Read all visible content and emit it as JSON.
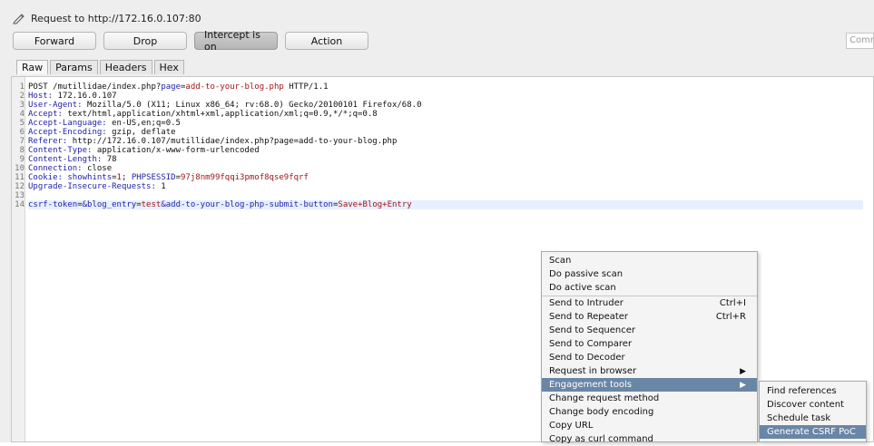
{
  "window": {
    "title": "Request to http://172.16.0.107:80"
  },
  "toolbar": {
    "forward": "Forward",
    "drop": "Drop",
    "intercept": "Intercept is on",
    "action": "Action",
    "comment_placeholder": "Comm"
  },
  "tabs": [
    "Raw",
    "Params",
    "Headers",
    "Hex"
  ],
  "editor": {
    "line_numbers": [
      "1",
      "2",
      "3",
      "4",
      "5",
      "6",
      "7",
      "8",
      "9",
      "10",
      "11",
      "12",
      "13",
      "14"
    ],
    "lines": [
      {
        "key": "POST /mutillidae/index.php?",
        "k2": "page",
        "eq": "=",
        "v": "add-to-your-blog.php",
        "rest": " HTTP/1.1"
      },
      {
        "key": "Host:",
        "v": " 172.16.0.107"
      },
      {
        "key": "User-Agent:",
        "v": " Mozilla/5.0 (X11; Linux x86_64; rv:68.0) Gecko/20100101 Firefox/68.0"
      },
      {
        "key": "Accept:",
        "v": " text/html,application/xhtml+xml,application/xml;q=0.9,*/*;q=0.8"
      },
      {
        "key": "Accept-Language:",
        "v": " en-US,en;q=0.5"
      },
      {
        "key": "Accept-Encoding:",
        "v": " gzip, deflate"
      },
      {
        "key": "Referer:",
        "v": " http://172.16.0.107/mutillidae/index.php?page=add-to-your-blog.php"
      },
      {
        "key": "Content-Type:",
        "v": " application/x-www-form-urlencoded"
      },
      {
        "key": "Content-Length:",
        "v": " 78"
      },
      {
        "key": "Connection:",
        "v": " close"
      },
      {
        "key": "Cookie:",
        "c1": " showhints",
        "c1eq": "=",
        "c1v": "1",
        "sep": "; ",
        "c2": "PHPSESSID",
        "c2eq": "=",
        "c2v": "97j8nm99fqqi3pmof8qse9fqrf"
      },
      {
        "key": "Upgrade-Insecure-Requests:",
        "v": " 1"
      },
      {
        "key": "",
        "v": ""
      },
      {
        "p1": "csrf-token",
        "e1": "=",
        "p2": "&blog_entry",
        "e2": "=",
        "v2": "test",
        "p3": "&add-to-your-blog-php-submit-button",
        "e3": "=",
        "v3": "Save+Blog+Entry"
      }
    ]
  },
  "context_menu": {
    "items": [
      {
        "label": "Scan"
      },
      {
        "label": "Do passive scan"
      },
      {
        "label": "Do active scan"
      },
      {
        "label": "Send to Intruder",
        "shortcut": "Ctrl+I"
      },
      {
        "label": "Send to Repeater",
        "shortcut": "Ctrl+R"
      },
      {
        "label": "Send to Sequencer"
      },
      {
        "label": "Send to Comparer"
      },
      {
        "label": "Send to Decoder"
      },
      {
        "label": "Request in browser",
        "submenu": "▶"
      },
      {
        "label": "Engagement tools",
        "submenu": "▶"
      },
      {
        "label": "Change request method"
      },
      {
        "label": "Change body encoding"
      },
      {
        "label": "Copy URL"
      },
      {
        "label": "Copy as curl command"
      }
    ]
  },
  "submenu": {
    "items": [
      {
        "label": "Find references"
      },
      {
        "label": "Discover content"
      },
      {
        "label": "Schedule task"
      },
      {
        "label": "Generate CSRF PoC"
      }
    ]
  }
}
